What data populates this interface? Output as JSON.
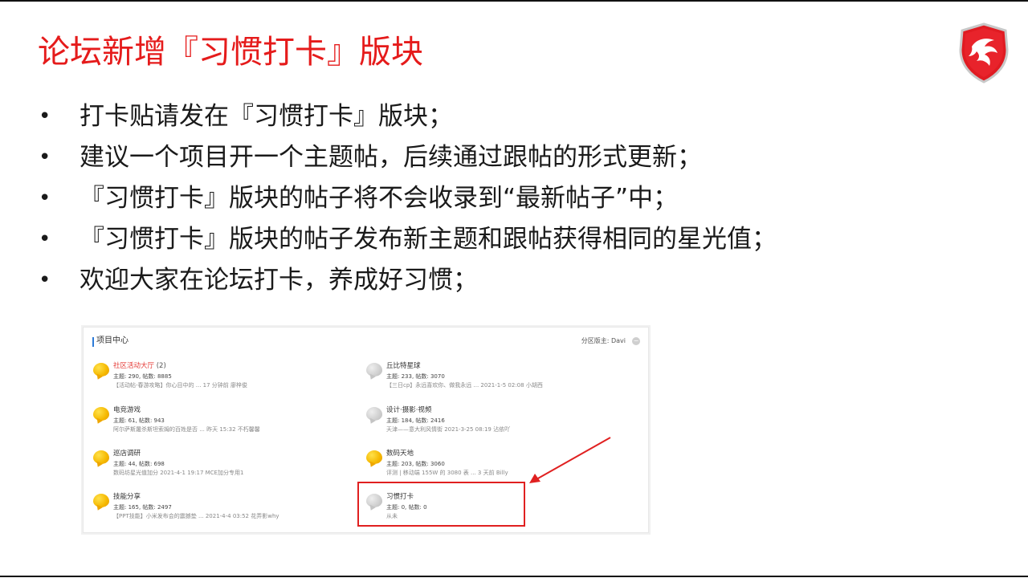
{
  "slide": {
    "title": "论坛新增『习惯打卡』版块",
    "bullet_glyph": "•",
    "bullets": [
      "打卡贴请发在『习惯打卡』版块；",
      "建议一个项目开一个主题帖，后续通过跟帖的形式更新；",
      "『习惯打卡』版块的帖子将不会收录到“最新帖子”中；",
      "『习惯打卡』版块的帖子发布新主题和跟帖获得相同的星光值；",
      "欢迎大家在论坛打卡，养成好习惯；"
    ]
  },
  "panel": {
    "title": "项目中心",
    "moderator": "分区版主: Davi",
    "collapse_glyph": "−",
    "forums": [
      {
        "name": "社区活动大厅",
        "count": "(2)",
        "stats": "主题: 290, 帖数: 8885",
        "latest": "【活动帖-春游攻略】你心目中的 ... 17 分钟前 廖梓俊"
      },
      {
        "name": "丘比特星球",
        "count": "",
        "stats": "主题: 233, 帖数: 3070",
        "latest": "【三日cp】永远喜欢你、做我永远 ... 2021-1-5 02:08 小胡西"
      },
      {
        "name": "电竞游戏",
        "count": "",
        "stats": "主题: 61, 帖数: 943",
        "latest": "阿尔萨斯屠杀斯坦索姆的百姓是否 ... 昨天 15:32 不朽馨馨"
      },
      {
        "name": "设计·摄影·视频",
        "count": "",
        "stats": "主题: 184, 帖数: 2416",
        "latest": "天津——意大利风情街 2021-3-25 08:19 沾依吖"
      },
      {
        "name": "巡店调研",
        "count": "",
        "stats": "主题: 44, 帖数: 698",
        "latest": "数码坊星光值加分 2021-4-1 19:17 MCE加分专用1"
      },
      {
        "name": "数码天地",
        "count": "",
        "stats": "主题: 203, 帖数: 3060",
        "latest": "评测 | 移动端 155W 的 3080 表 ... 3 天前 Billy"
      },
      {
        "name": "技能分享",
        "count": "",
        "stats": "主题: 165, 帖数: 2497",
        "latest": "【PPT技能】小米发布会的震撼垫 ... 2021-4-4 03:52 花弄影why"
      },
      {
        "name": "习惯打卡",
        "count": "",
        "stats": "主题: 0, 帖数: 0",
        "latest": "从未"
      }
    ]
  },
  "colors": {
    "title": "#e51b1b",
    "forum_active_icon": "#f5b800",
    "forum_new_icon": "#c4c4c4",
    "highlight": "#e02020",
    "panel_accent": "#2d7bd8"
  },
  "icons": {
    "logo": "msi-dragon-shield-icon",
    "forum_icon": "speech-bubble-icon",
    "collapse": "collapse-circle-icon"
  }
}
